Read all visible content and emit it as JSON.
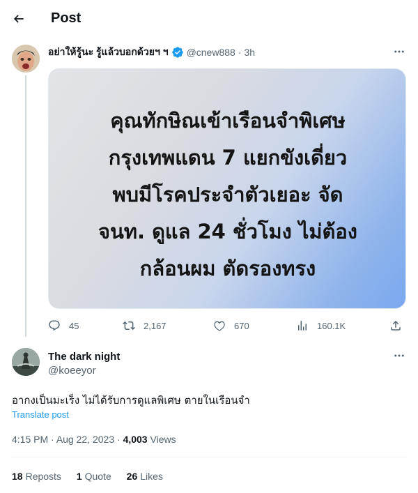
{
  "header": {
    "title": "Post"
  },
  "parent_tweet": {
    "name": "อย่าให้รู้นะ รู้แล้วบอกด้วยฯ ฯ",
    "handle": "@cnew888",
    "separator": "·",
    "time": "3h",
    "image_text": [
      "คุณทักษิณเข้าเรือนจำพิเศษ",
      "กรุงเทพแดน 7 แยกขังเดี่ยว",
      "พบมีโรคประจำตัวเยอะ จัด",
      "จนท. ดูแล 24 ชั่วโมง ไม่ต้อง",
      "กล้อนผม ตัดรองทรง"
    ],
    "actions": {
      "replies": "45",
      "reposts": "2,167",
      "likes": "670",
      "views": "160.1K"
    }
  },
  "reply_tweet": {
    "name": "The dark night",
    "handle": "@koeeyor",
    "text": "อากงเป็นมะเร็ง ไม่ได้รับการดูแลพิเศษ ตายในเรือนจำ",
    "translate_label": "Translate post",
    "time": "4:15 PM",
    "date": "Aug 22, 2023",
    "views_count": "4,003",
    "views_label": "Views",
    "reposts_count": "18",
    "reposts_label": "Reposts",
    "quotes_count": "1",
    "quotes_label": "Quote",
    "likes_count": "26",
    "likes_label": "Likes"
  },
  "colors": {
    "accent": "#1d9bf0",
    "secondary_text": "#536471"
  }
}
